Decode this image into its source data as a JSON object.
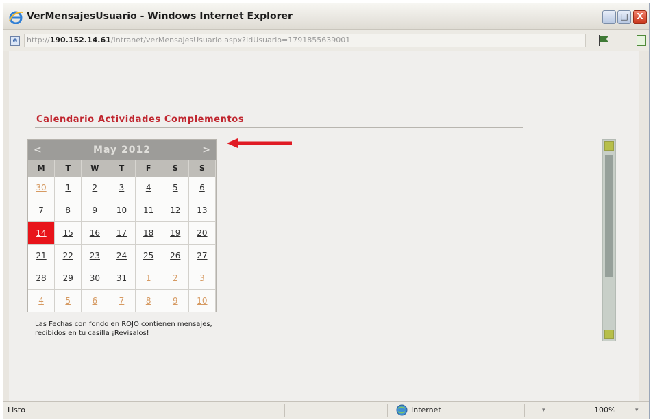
{
  "window": {
    "title": "VerMensajesUsuario - Windows Internet Explorer",
    "buttons": {
      "minimize": "_",
      "maximize": "□",
      "close": "X"
    }
  },
  "address": {
    "prefix": "http://",
    "host": "190.152.14.61",
    "path": "/Intranet/verMensajesUsuario.aspx?IdUsuario=1791855639001"
  },
  "page": {
    "heading": "Calendario Actividades Complementos",
    "note": "Las Fechas con fondo en ROJO contienen mensajes, recibidos en tu casilla ¡Revisalos!"
  },
  "calendar": {
    "prev": "<",
    "next": ">",
    "title": "May 2012",
    "weekdays": [
      "M",
      "T",
      "W",
      "T",
      "F",
      "S",
      "S"
    ],
    "weeks": [
      [
        {
          "d": "30",
          "other": true
        },
        {
          "d": "1"
        },
        {
          "d": "2"
        },
        {
          "d": "3"
        },
        {
          "d": "4"
        },
        {
          "d": "5"
        },
        {
          "d": "6"
        }
      ],
      [
        {
          "d": "7"
        },
        {
          "d": "8"
        },
        {
          "d": "9"
        },
        {
          "d": "10"
        },
        {
          "d": "11"
        },
        {
          "d": "12"
        },
        {
          "d": "13"
        }
      ],
      [
        {
          "d": "14",
          "highlight": true
        },
        {
          "d": "15"
        },
        {
          "d": "16"
        },
        {
          "d": "17"
        },
        {
          "d": "18"
        },
        {
          "d": "19"
        },
        {
          "d": "20"
        }
      ],
      [
        {
          "d": "21"
        },
        {
          "d": "22"
        },
        {
          "d": "23"
        },
        {
          "d": "24"
        },
        {
          "d": "25"
        },
        {
          "d": "26"
        },
        {
          "d": "27"
        }
      ],
      [
        {
          "d": "28"
        },
        {
          "d": "29"
        },
        {
          "d": "30"
        },
        {
          "d": "31"
        },
        {
          "d": "1",
          "other": true
        },
        {
          "d": "2",
          "other": true
        },
        {
          "d": "3",
          "other": true
        }
      ],
      [
        {
          "d": "4",
          "other": true
        },
        {
          "d": "5",
          "other": true
        },
        {
          "d": "6",
          "other": true
        },
        {
          "d": "7",
          "other": true
        },
        {
          "d": "8",
          "other": true
        },
        {
          "d": "9",
          "other": true
        },
        {
          "d": "10",
          "other": true
        }
      ]
    ]
  },
  "status": {
    "left": "Listo",
    "zone": "Internet",
    "zoom": "100%"
  },
  "colors": {
    "heading": "#c0262f",
    "highlight": "#e8141a",
    "arrow": "#e01b24",
    "calendar_header": "#9d9c99"
  },
  "icons": [
    "ie-logo-icon",
    "page-icon",
    "flag-icon",
    "page-green-icon",
    "arrow-left-icon",
    "globe-icon"
  ]
}
